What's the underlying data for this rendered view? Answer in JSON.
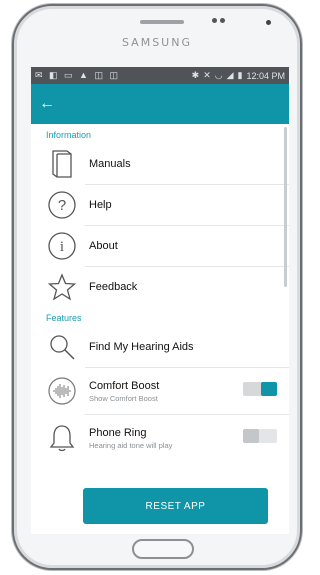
{
  "device": {
    "brand": "SAMSUNG"
  },
  "status_bar": {
    "time": "12:04 PM"
  },
  "sections": {
    "information": "Information",
    "features": "Features"
  },
  "items": {
    "manuals": "Manuals",
    "help": "Help",
    "about": "About",
    "feedback": "Feedback",
    "find": "Find My Hearing Aids",
    "comfort": {
      "label": "Comfort Boost",
      "sub": "Show Comfort Boost",
      "enabled": true
    },
    "phone": {
      "label": "Phone Ring",
      "sub": "Hearing aid tone will play",
      "enabled": false
    }
  },
  "footer": {
    "reset_label": "RESET APP"
  },
  "colors": {
    "accent": "#0f94a8",
    "status_bar": "#505357"
  }
}
